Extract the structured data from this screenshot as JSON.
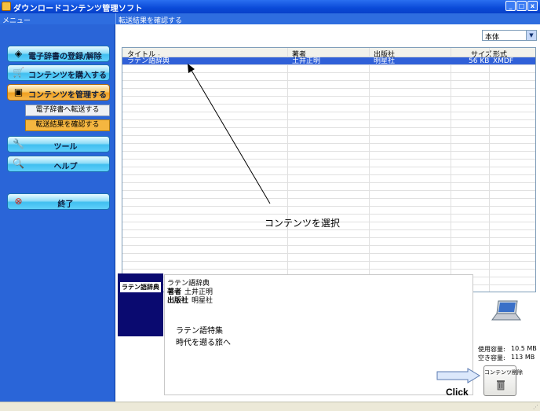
{
  "window": {
    "title": "ダウンロードコンテンツ管理ソフト",
    "buttons": {
      "minimize": "_",
      "maximize": "□",
      "close": "x"
    }
  },
  "sidebar": {
    "header": "メニュー",
    "items": [
      {
        "label": "電子辞書の登録/解除",
        "icon": "device-icon"
      },
      {
        "label": "コンテンツを購入する",
        "icon": "cart-icon"
      },
      {
        "label": "コンテンツを管理する",
        "icon": "manage-icon",
        "active": true
      },
      {
        "label": "電子辞書へ転送する",
        "sub": true
      },
      {
        "label": "転送結果を確認する",
        "sub": true,
        "active": true
      },
      {
        "label": "ツール",
        "icon": "wrench-icon"
      },
      {
        "label": "ヘルプ",
        "icon": "help-icon"
      },
      {
        "label": "終了",
        "icon": "exit-icon"
      }
    ]
  },
  "main": {
    "header": "転送結果を確認する",
    "location_select": "本体",
    "table": {
      "columns": [
        "タイトル",
        "著者",
        "出版社",
        "サイズ",
        "形式"
      ],
      "sort_indicator": "-",
      "rows": [
        {
          "title": "ラテン語辞典",
          "author": "土井正明",
          "publisher": "明星社",
          "size": "56 KB",
          "format": "XMDF",
          "selected": true
        }
      ]
    },
    "annotation": "コンテンツを選択",
    "detail": {
      "cover_label": "ラテン語辞典",
      "title": "ラテン語辞典",
      "author_label": "著者",
      "author": "土井正明",
      "publisher_label": "出版社",
      "publisher": "明星社",
      "description_line1": "ラテン語特集",
      "description_line2": "時代を遡る旅へ"
    },
    "capacity": {
      "used_label": "使用容量:",
      "used_value": "10.5 MB",
      "free_label": "空き容量:",
      "free_value": "113 MB"
    },
    "delete_button": "コンテンツ削除",
    "click_label": "Click"
  }
}
